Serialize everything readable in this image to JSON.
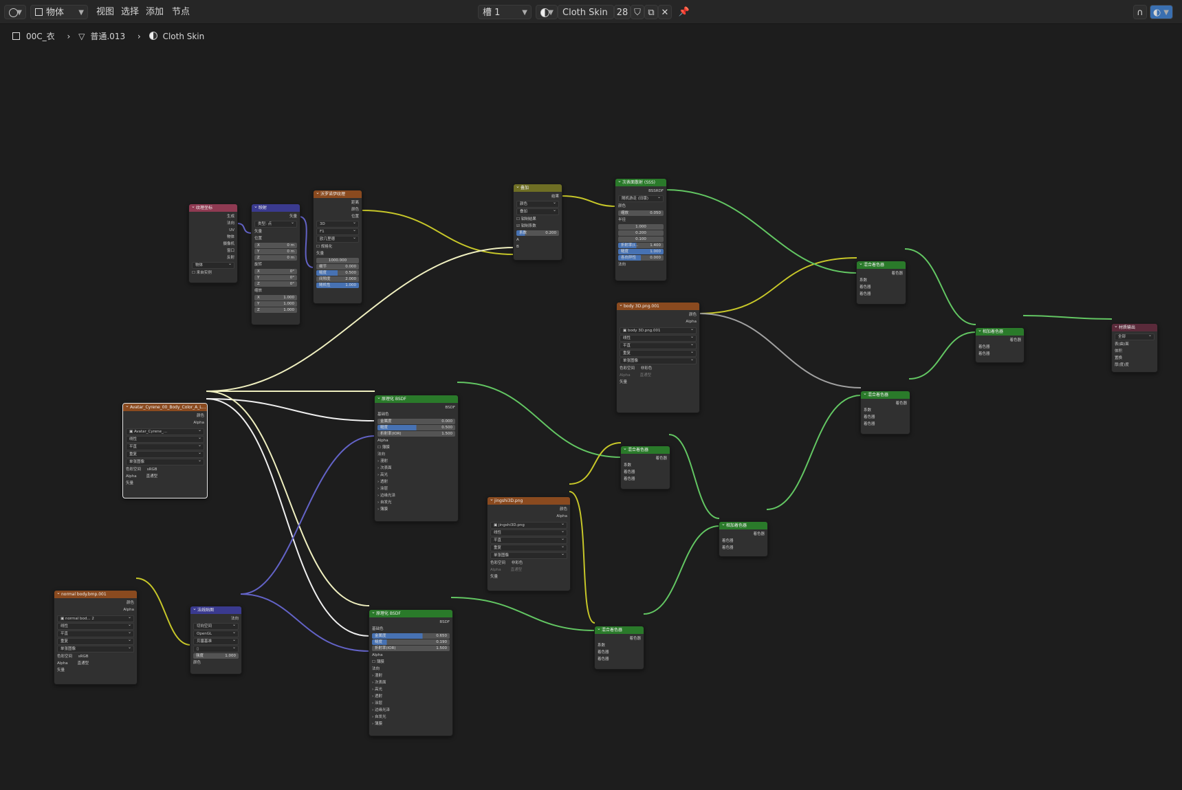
{
  "topbar": {
    "editor_type_icon": "shader-editor-icon",
    "object_mode": "物体",
    "menus": [
      "视图",
      "选择",
      "添加",
      "节点"
    ],
    "slot": "槽 1",
    "material_name": "Cloth Skin",
    "user_count": "28"
  },
  "breadcrumb": {
    "object": "00C_衣",
    "mesh": "普通.013",
    "material": "Cloth Skin"
  },
  "nodes": {
    "texcoord": {
      "title": "纹理坐标",
      "outputs": [
        "生成",
        "法向",
        "UV",
        "物体",
        "摄像机",
        "窗口",
        "反射"
      ],
      "object_label": "物体",
      "from_instancer": "来自实例"
    },
    "mapping": {
      "title": "映射",
      "output": "矢量",
      "type_label": "类型:",
      "type_value": "点",
      "input_vector": "矢量",
      "location_label": "位置",
      "rotation_label": "旋转",
      "scale_label": "缩放",
      "loc": [
        "0 m",
        "0 m",
        "0 m"
      ],
      "rot": [
        "0°",
        "0°",
        "0°"
      ],
      "scale": [
        "1.000",
        "1.000",
        "1.000"
      ],
      "axes": [
        "X",
        "Y",
        "Z"
      ]
    },
    "voronoi": {
      "title": "沃罗诺伊纹理",
      "outputs": [
        "距离",
        "颜色",
        "位置"
      ],
      "dim": "3D",
      "feature": "F1",
      "metric": "欧几里德",
      "normalize": "规格化",
      "input_vector": "矢量",
      "scale": "1000.000",
      "detail_label": "细节",
      "detail": "0.000",
      "rough_label": "糙度",
      "rough": "0.500",
      "lacun_label": "间隙度",
      "lacun": "2.000",
      "random_label": "随机性",
      "random": "1.000"
    },
    "mix_overlay": {
      "title": "叠加",
      "output": "结果",
      "color_mode": "颜色",
      "blend": "叠加",
      "clamp_result": "钳制结果",
      "clamp_factor": "钳制系数",
      "factor_label": "系数",
      "factor": "0.200",
      "a": "A",
      "b": "B"
    },
    "sss": {
      "title": "次表面散射 (SSS)",
      "output": "BSSRDF",
      "method": "随机游走 (旧版)",
      "color": "颜色",
      "scale_label": "缩放",
      "scale": "0.050",
      "radius_label": "半径",
      "radius": [
        "1.000",
        "0.200",
        "0.100"
      ],
      "ior_label": "折射率(I...",
      "ior": "1.400",
      "rough_label": "糙度",
      "rough": "1.000",
      "aniso_label": "各向异性",
      "aniso": "0.000",
      "normal": "法向"
    },
    "body3d": {
      "title": "body 3D.png.001",
      "outputs": [
        "颜色",
        "Alpha"
      ],
      "image": "body 3D.png.001",
      "interp": "线性",
      "proj": "平直",
      "ext": "重复",
      "source": "单张图像",
      "colorspace_label": "色彩空间",
      "colorspace": "非彩色",
      "alpha_label": "Alpha",
      "alpha": "直通型",
      "vector": "矢量"
    },
    "avatar_tex": {
      "title": "Avatar_Cyrene_00_Body_Color_A_L...",
      "outputs": [
        "颜色",
        "Alpha"
      ],
      "image": "Avatar_Cyrene_...",
      "interp": "线性",
      "proj": "平直",
      "ext": "重复",
      "source": "单张图像",
      "colorspace_label": "色彩空间",
      "colorspace": "sRGB",
      "alpha_label": "Alpha",
      "alpha": "直通型",
      "vector": "矢量"
    },
    "bsdf1": {
      "title": "原理化 BSDF",
      "output": "BSDF",
      "base": "基础色",
      "metal_label": "金属度",
      "metal": "0.000",
      "rough_label": "糙度",
      "rough": "0.500",
      "ior_label": "折射率(IOR)",
      "ior": "1.500",
      "alpha": "Alpha",
      "thin": "薄膜",
      "normal": "法向",
      "panels": [
        "漫射",
        "次表面",
        "高光",
        "透射",
        "涂层",
        "边缘光泽",
        "自发光",
        "薄膜"
      ]
    },
    "bsdf2": {
      "title": "原理化 BSDF",
      "output": "BSDF",
      "base": "基础色",
      "metal_label": "金属度",
      "metal": "0.650",
      "rough_label": "糙度",
      "rough": "0.190",
      "ior_label": "折射率(IOR)",
      "ior": "1.500",
      "alpha": "Alpha",
      "thin": "薄膜",
      "normal": "法向",
      "panels": [
        "漫射",
        "次表面",
        "高光",
        "透射",
        "涂层",
        "边缘光泽",
        "自发光",
        "薄膜"
      ]
    },
    "jingshi": {
      "title": "jingshi3D.png",
      "outputs": [
        "颜色",
        "Alpha"
      ],
      "image": "jingshi3D.png",
      "interp": "线性",
      "proj": "平直",
      "ext": "重复",
      "source": "单张图像",
      "colorspace_label": "色彩空间",
      "colorspace": "非彩色",
      "alpha_label": "Alpha",
      "alpha": "直通型",
      "vector": "矢量"
    },
    "normal_tex": {
      "title": "normal body.bmp.001",
      "outputs": [
        "颜色",
        "Alpha"
      ],
      "image": "normal bod...",
      "users": "2",
      "interp": "线性",
      "proj": "平直",
      "ext": "重复",
      "source": "单张图像",
      "colorspace_label": "色彩空间",
      "colorspace": "sRGB",
      "alpha_label": "Alpha",
      "alpha": "直通型",
      "vector": "矢量"
    },
    "normal_map": {
      "title": "法线贴图",
      "output": "法向",
      "space": "切向空间",
      "convention": "OpenGL",
      "uv": "贝塞基准",
      "strength_label": "强度",
      "strength": "1.000",
      "color": "颜色"
    },
    "mix1": {
      "title": "混合着色器",
      "output": "着色器",
      "inputs": [
        "系数",
        "着色器",
        "着色器"
      ]
    },
    "mix2": {
      "title": "混合着色器",
      "output": "着色器",
      "inputs": [
        "系数",
        "着色器",
        "着色器"
      ]
    },
    "mix3": {
      "title": "混合着色器",
      "output": "着色器",
      "inputs": [
        "系数",
        "着色器",
        "着色器"
      ]
    },
    "mix4": {
      "title": "混合着色器",
      "output": "着色器",
      "inputs": [
        "系数",
        "着色器",
        "着色器"
      ]
    },
    "add1": {
      "title": "相加着色器",
      "output": "着色器",
      "inputs": [
        "着色器",
        "着色器"
      ]
    },
    "add2": {
      "title": "相加着色器",
      "output": "着色器",
      "inputs": [
        "着色器",
        "着色器"
      ]
    },
    "output": {
      "title": "材质输出",
      "target": "全部",
      "inputs": [
        "表(曲)面",
        "体积",
        "置换",
        "厚(度)度"
      ]
    }
  },
  "colors": {
    "header_texcoord": "#8f3a52",
    "header_vector": "#3a3a8f",
    "header_texture": "#8a4a1f",
    "header_color": "#6e6e24",
    "header_shader": "#2a7a2a",
    "header_output": "#5a2a3a",
    "wire_color": "#c7c729",
    "wire_shader": "#63c763",
    "wire_vector": "#6363c7",
    "wire_gray": "#a1a1a1",
    "wire_selected": "#f0f0d0"
  }
}
